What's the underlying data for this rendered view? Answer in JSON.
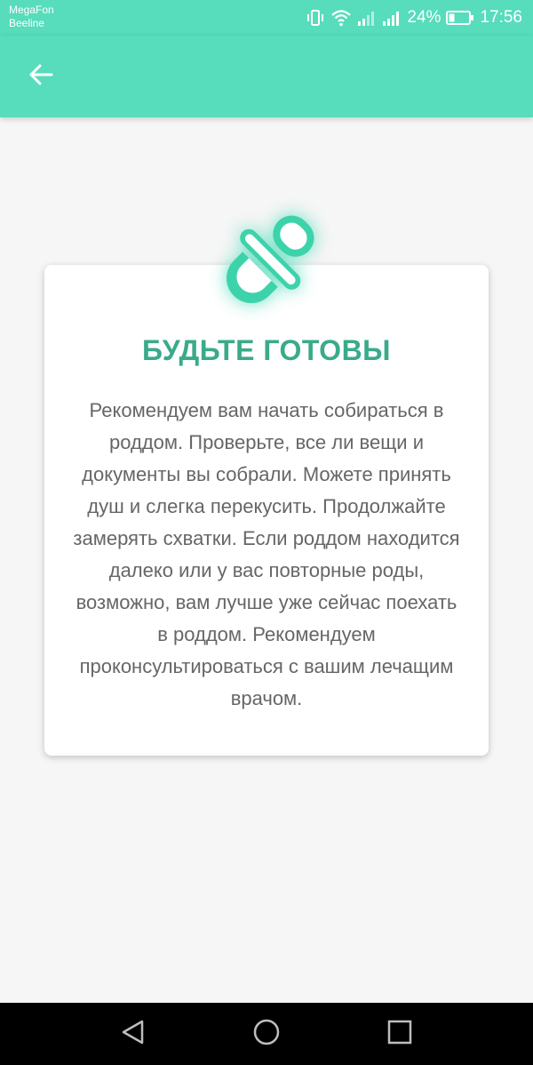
{
  "status_bar": {
    "carrier_1": "MegaFon",
    "carrier_2": "Beeline",
    "battery": "24%",
    "time": "17:56"
  },
  "app_bar": {
    "back_icon": "arrow-left-icon"
  },
  "card": {
    "icon": "pacifier-icon",
    "title": "БУДЬТЕ ГОТОВЫ",
    "text": "Рекомендуем вам начать собираться в роддом. Проверьте, все ли вещи и документы вы собрали. Можете принять душ и слегка перекусить. Продолжайте замерять схватки. Если роддом находится далеко или у вас повторные роды, возможно, вам лучше уже сейчас поехать в роддом. Рекомендуем проконсультироваться с вашим лечащим врачом."
  },
  "nav_bar": {
    "back": "nav-back-icon",
    "home": "nav-home-icon",
    "recents": "nav-recents-icon"
  },
  "colors": {
    "accent": "#57dcbc",
    "title": "#3aaa8a",
    "text": "#666666",
    "background": "#f6f6f6"
  }
}
